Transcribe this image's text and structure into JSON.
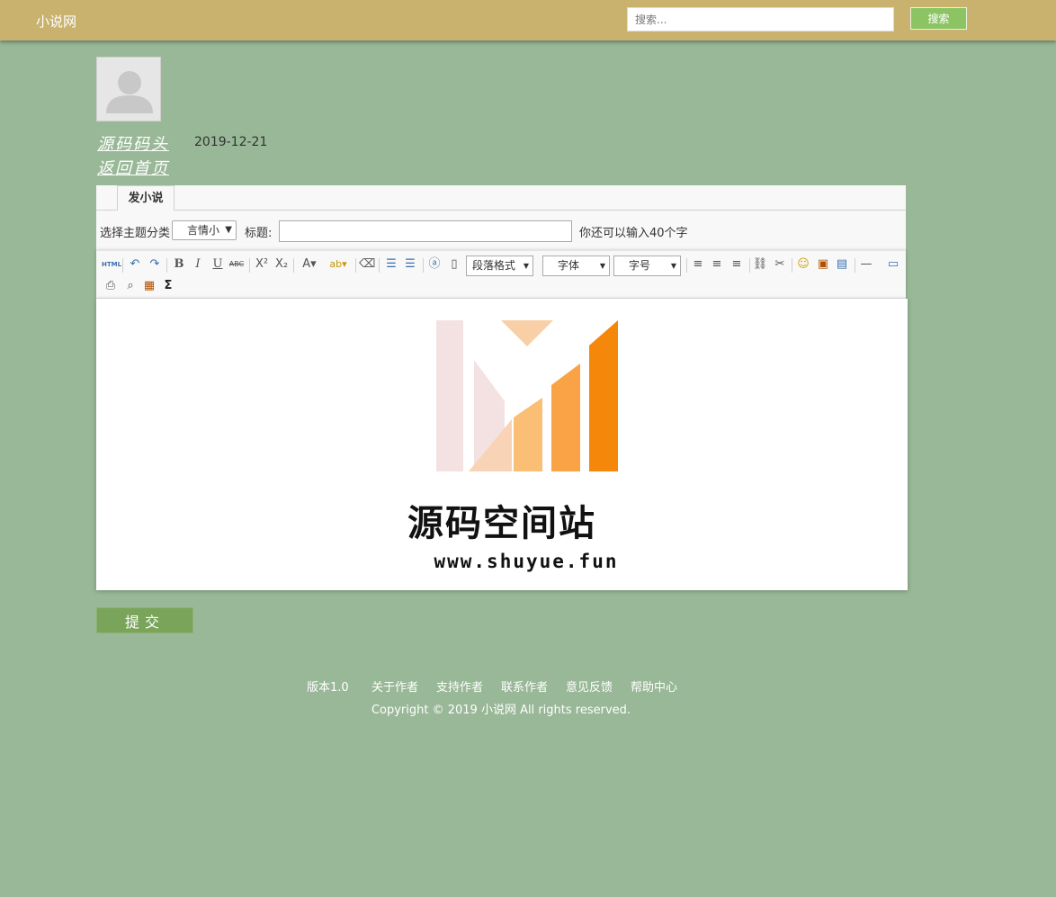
{
  "header": {
    "brand": "小说网",
    "search_placeholder": "搜索...",
    "search_button": "搜索"
  },
  "profile": {
    "author": "源码码头",
    "date": "2019-12-21",
    "home_link": "返回首页"
  },
  "editor": {
    "tab_label": "发小说",
    "category_label": "选择主题分类",
    "category_selected": "言情小",
    "title_label": "标题:",
    "title_value": "",
    "char_hint": "你还可以输入40个字",
    "toolbar": {
      "html_label": "HTML",
      "paragraph_select": "段落格式",
      "font_select": "字体",
      "size_select": "字号"
    },
    "content": {
      "logo_title": "源码空间站",
      "logo_url": "www.shuyue.fun"
    }
  },
  "submit_label": "提交",
  "footer": {
    "links": [
      "版本1.0",
      "关于作者",
      "支持作者",
      "联系作者",
      "意见反馈",
      "帮助中心"
    ],
    "copyright": "Copyright © 2019 小说网 All rights reserved."
  },
  "colors": {
    "header_bg": "#c9b26e",
    "page_bg": "#99b897",
    "search_button": "#8cc464",
    "submit_button": "#7aa45a",
    "logo_orange": "#f5880a"
  }
}
